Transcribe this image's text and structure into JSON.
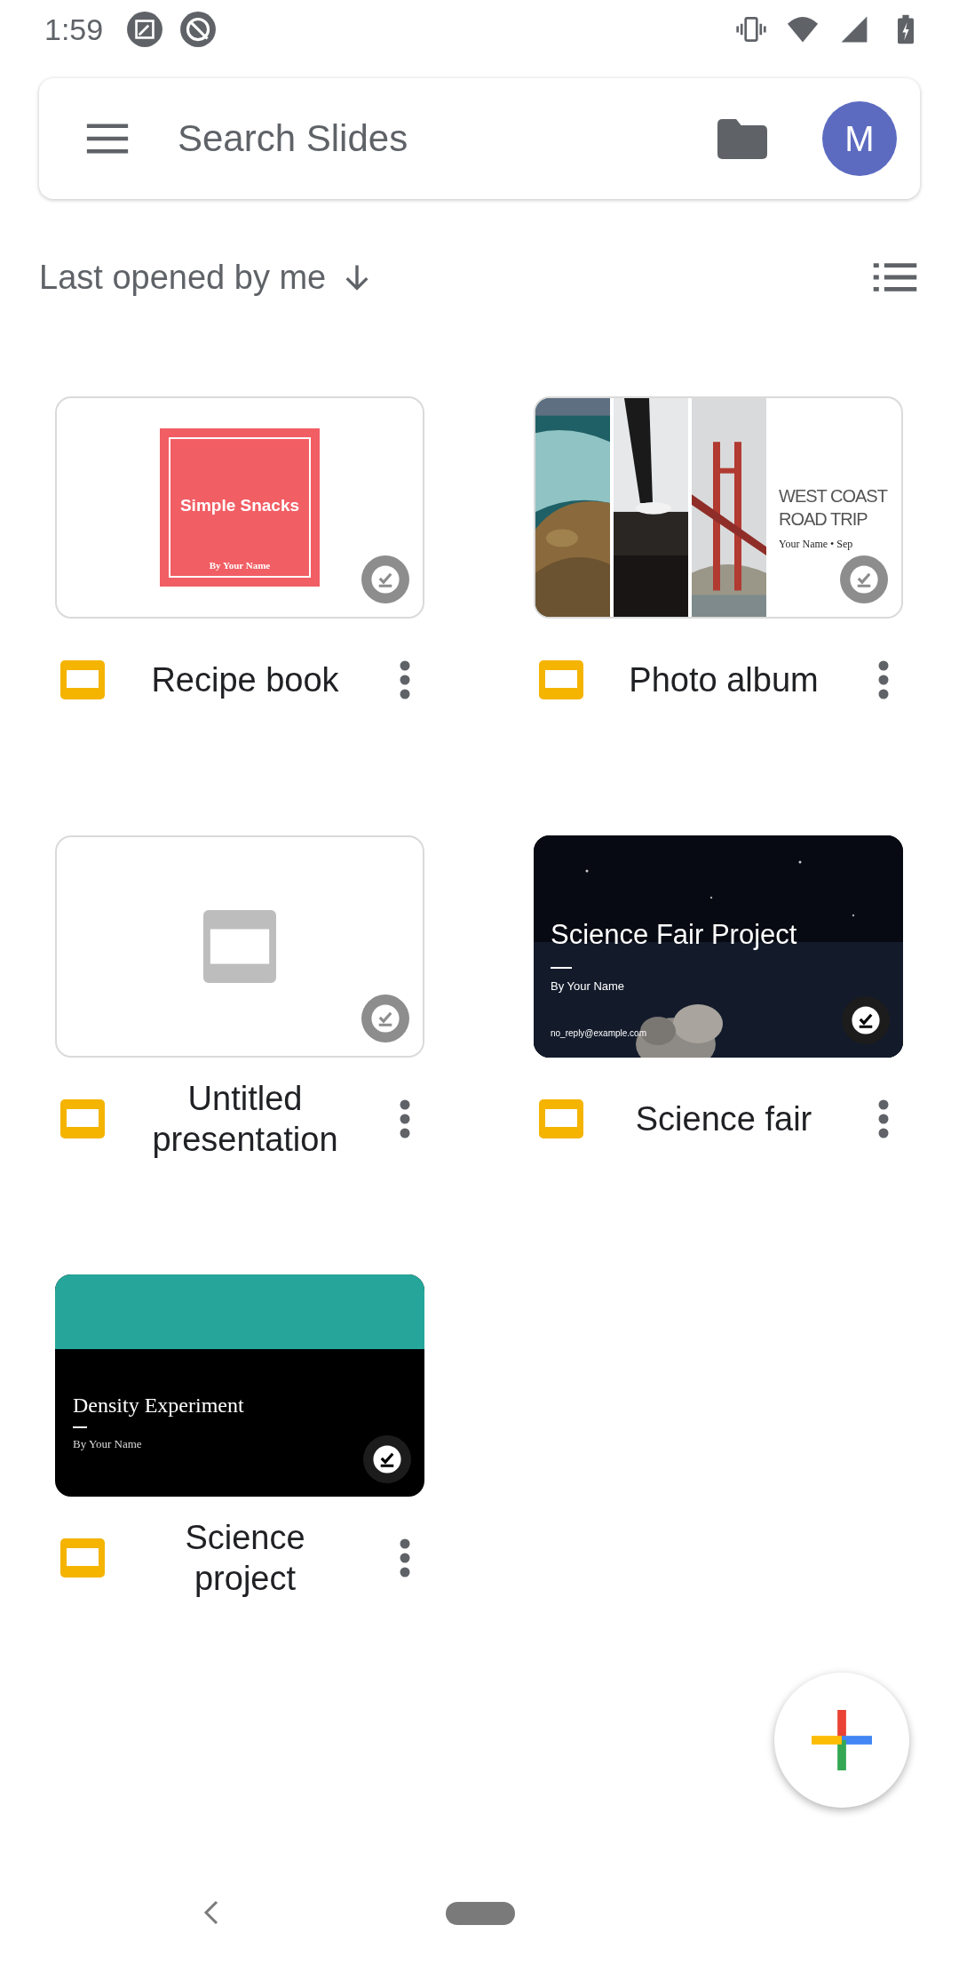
{
  "status_bar": {
    "time": "1:59"
  },
  "search": {
    "placeholder": "Search Slides",
    "avatar": "M"
  },
  "sort": {
    "label": "Last opened by me"
  },
  "files": [
    {
      "name": "Recipe book",
      "thumbnail": {
        "kind": "square",
        "title": "Simple Snacks",
        "subtitle": "By Your Name"
      }
    },
    {
      "name": "Photo album",
      "thumbnail": {
        "kind": "photos",
        "title_lines": [
          "WEST COAST",
          "ROAD TRIP"
        ],
        "subtitle": "Your Name • Sep"
      }
    },
    {
      "name": "Untitled presentation",
      "thumbnail": {
        "kind": "blank"
      }
    },
    {
      "name": "Science fair",
      "thumbnail": {
        "kind": "night",
        "title": "Science Fair Project",
        "subtitle": "By Your Name",
        "footer": "no_reply@example.com"
      }
    },
    {
      "name": "Science project",
      "thumbnail": {
        "kind": "banner",
        "title": "Density Experiment",
        "subtitle": "By Your Name"
      }
    }
  ]
}
